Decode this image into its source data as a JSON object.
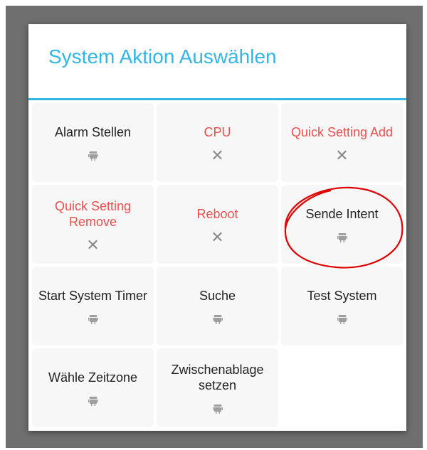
{
  "dialog": {
    "title": "System Aktion Auswählen",
    "accent_color": "#33b5e5"
  },
  "actions": [
    {
      "label": "Alarm Stellen",
      "color": "default",
      "icon": "android-icon"
    },
    {
      "label": "CPU",
      "color": "red",
      "icon": "close-icon"
    },
    {
      "label": "Quick Setting Add",
      "color": "red",
      "icon": "close-icon"
    },
    {
      "label": "Quick Setting Remove",
      "color": "red",
      "icon": "close-icon"
    },
    {
      "label": "Reboot",
      "color": "red",
      "icon": "close-icon"
    },
    {
      "label": "Sende Intent",
      "color": "default",
      "icon": "android-icon"
    },
    {
      "label": "Start System Timer",
      "color": "default",
      "icon": "android-icon"
    },
    {
      "label": "Suche",
      "color": "default",
      "icon": "android-icon"
    },
    {
      "label": "Test System",
      "color": "default",
      "icon": "android-icon"
    },
    {
      "label": "Wähle Zeitzone",
      "color": "default",
      "icon": "android-icon"
    },
    {
      "label": "Zwischenablage setzen",
      "color": "default",
      "icon": "android-icon"
    }
  ],
  "colors": {
    "label_default": "#222222",
    "label_unavailable": "#f04e4e",
    "annotation": "#e00000"
  },
  "icons": {
    "x_glyph": "✕"
  }
}
